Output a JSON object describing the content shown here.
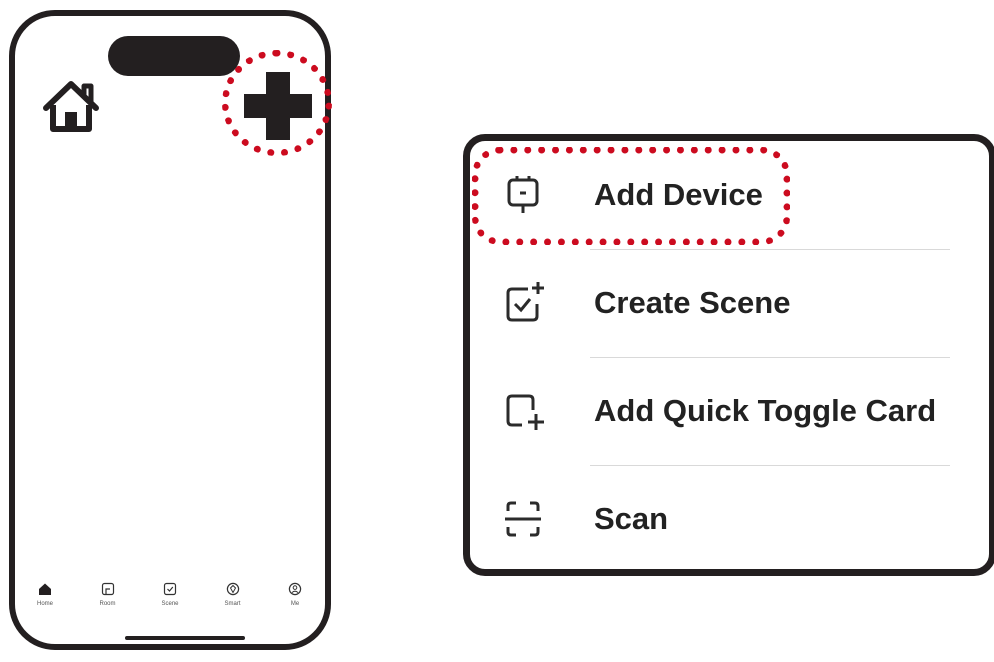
{
  "phone": {
    "tabs": [
      {
        "label": "Home",
        "icon": "house-filled-icon"
      },
      {
        "label": "Room",
        "icon": "room-icon"
      },
      {
        "label": "Scene",
        "icon": "scene-check-icon"
      },
      {
        "label": "Smart",
        "icon": "smart-icon"
      },
      {
        "label": "Me",
        "icon": "profile-icon"
      }
    ],
    "home_icon": "house-icon",
    "add_icon": "plus-icon"
  },
  "menu": {
    "items": [
      {
        "label": "Add Device",
        "icon": "device-icon"
      },
      {
        "label": "Create Scene",
        "icon": "create-scene-icon"
      },
      {
        "label": "Add Quick Toggle Card",
        "icon": "add-card-icon"
      },
      {
        "label": "Scan",
        "icon": "scan-icon"
      }
    ]
  },
  "colors": {
    "highlight": "#cc0b1f",
    "outline": "#231f20",
    "text": "#222222"
  }
}
